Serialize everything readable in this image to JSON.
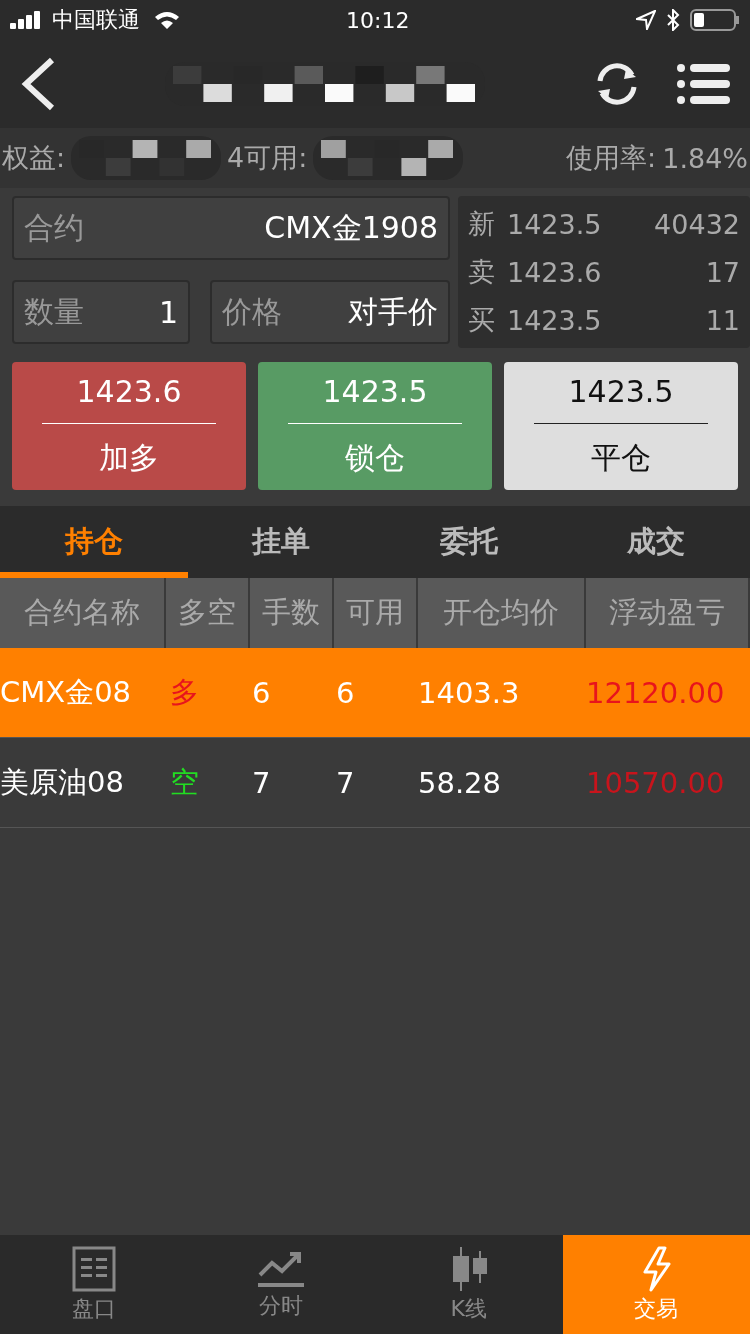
{
  "status_bar": {
    "carrier": "中国联通",
    "time": "10:12"
  },
  "account": {
    "equity_label": "权益:",
    "available_label": "4可用:",
    "usage_label": "使用率:",
    "usage": "1.84%"
  },
  "order": {
    "contract_label": "合约",
    "contract": "CMX金1908",
    "qty_label": "数量",
    "qty": "1",
    "price_label": "价格",
    "price": "对手价"
  },
  "quote": [
    {
      "label": "新",
      "price": "1423.5",
      "volume": "40432"
    },
    {
      "label": "卖",
      "price": "1423.6",
      "volume": "17"
    },
    {
      "label": "买",
      "price": "1423.5",
      "volume": "11"
    }
  ],
  "actions": [
    {
      "kind": "buy",
      "price": "1423.6",
      "label": "加多"
    },
    {
      "kind": "lock",
      "price": "1423.5",
      "label": "锁仓"
    },
    {
      "kind": "close",
      "price": "1423.5",
      "label": "平仓"
    }
  ],
  "tabs": [
    {
      "label": "持仓",
      "selected": true
    },
    {
      "label": "挂单",
      "selected": false
    },
    {
      "label": "委托",
      "selected": false
    },
    {
      "label": "成交",
      "selected": false
    }
  ],
  "table": {
    "columns": [
      "合约名称",
      "多空",
      "手数",
      "可用",
      "开仓均价",
      "浮动盈亏"
    ],
    "rows": [
      {
        "selected": true,
        "name": "CMX金08",
        "side": "多",
        "kind": "long",
        "lots": "6",
        "available": "6",
        "avg": "1403.3",
        "pnl": "12120.00"
      },
      {
        "selected": false,
        "name": "美原油08",
        "side": "空",
        "kind": "short",
        "lots": "7",
        "available": "7",
        "avg": "58.28",
        "pnl": "10570.00"
      }
    ]
  },
  "bottom_nav": [
    {
      "kind": "book",
      "label": "盘口",
      "selected": false
    },
    {
      "kind": "trend",
      "label": "分时",
      "selected": false
    },
    {
      "kind": "candle",
      "label": "K线",
      "selected": false
    },
    {
      "kind": "bolt",
      "label": "交易",
      "selected": true
    }
  ]
}
